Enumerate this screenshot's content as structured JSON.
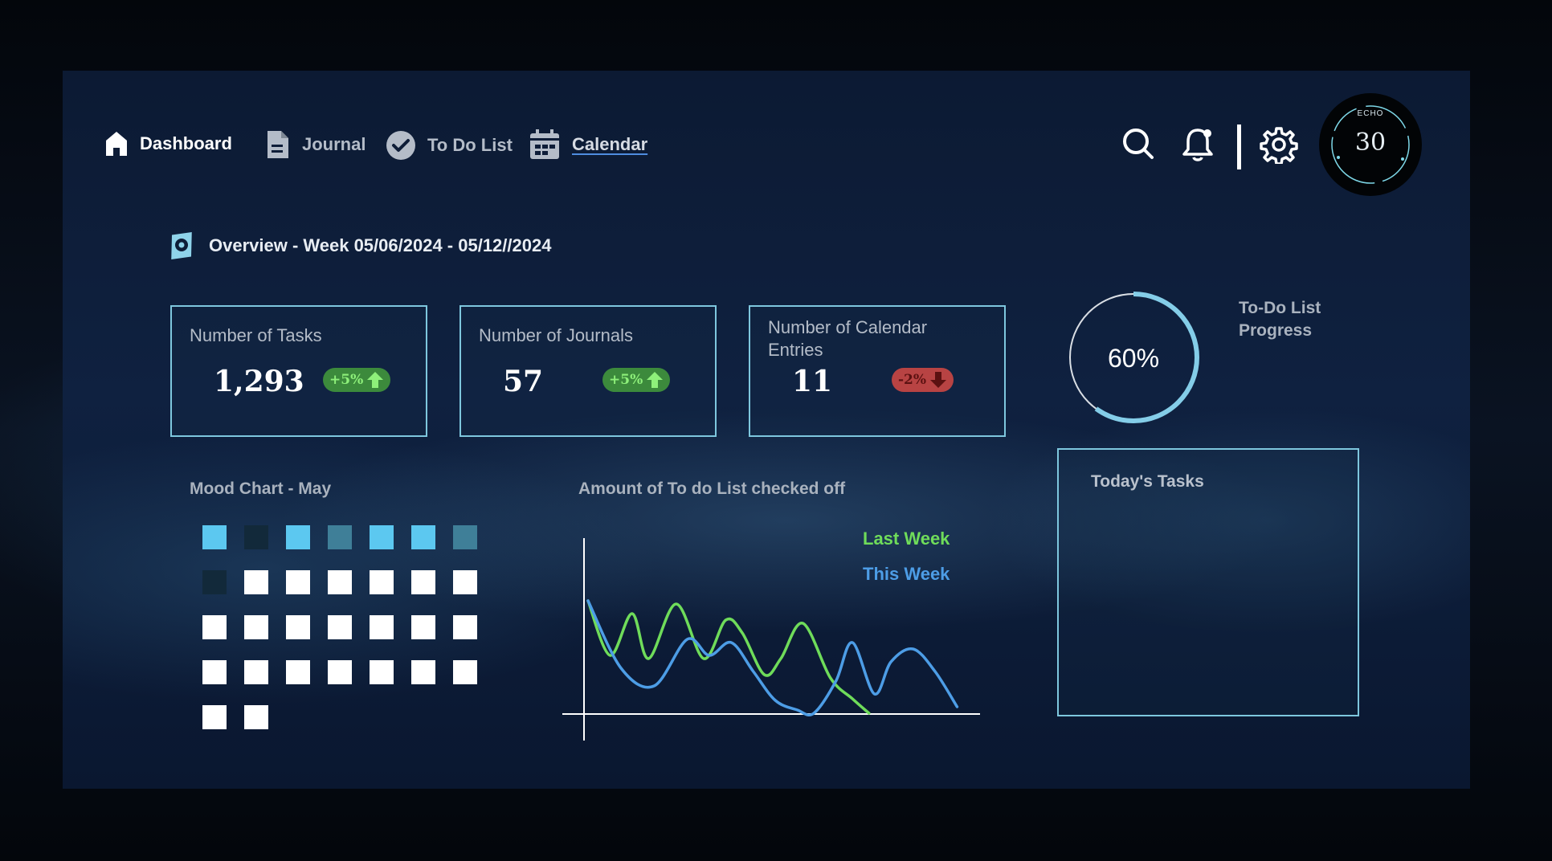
{
  "nav": {
    "items": [
      {
        "label": "Dashboard",
        "icon": "home-icon"
      },
      {
        "label": "Journal",
        "icon": "document-icon"
      },
      {
        "label": "To Do List",
        "icon": "check-circle-icon"
      },
      {
        "label": "Calendar",
        "icon": "calendar-icon"
      }
    ],
    "actions": [
      "search-icon",
      "bell-icon",
      "gear-icon"
    ],
    "badge": {
      "top_text": "ECHO",
      "number": "30"
    }
  },
  "overview": {
    "title": "Overview - Week 05/06/2024 - 05/12//2024",
    "icon": "camera-lens-icon"
  },
  "stats": [
    {
      "title": "Number of Tasks",
      "value": "1,293",
      "change": "+5%",
      "direction": "up"
    },
    {
      "title": "Number of Journals",
      "value": "57",
      "change": "+5%",
      "direction": "up"
    },
    {
      "title": "Number of Calendar Entries",
      "value": "11",
      "change": "-2%",
      "direction": "down"
    }
  ],
  "progress": {
    "value_text": "60%",
    "fraction": 0.6,
    "label": "To-Do List Progress"
  },
  "mood": {
    "title": "Mood Chart - May",
    "colors": {
      "bright": "#5cc8f0",
      "dark": "#12293a",
      "muted": "#3f7f98",
      "empty": "#ffffff"
    },
    "cells": [
      "bright",
      "dark",
      "bright",
      "muted",
      "bright",
      "bright",
      "muted",
      "dark",
      "empty",
      "empty",
      "empty",
      "empty",
      "empty",
      "empty",
      "empty",
      "empty",
      "empty",
      "empty",
      "empty",
      "empty",
      "empty",
      "empty",
      "empty",
      "empty",
      "empty",
      "empty",
      "empty",
      "empty",
      "empty",
      "empty"
    ]
  },
  "todays_tasks": {
    "title": "Today's Tasks"
  },
  "chart_data": {
    "type": "line",
    "title": "Amount of To do List checked off",
    "xlabel": "",
    "ylabel": "",
    "grid": false,
    "legend_placement": "top-right",
    "series": [
      {
        "name": "Last Week",
        "color": "#6fdc5a",
        "points": [
          [
            0,
            70
          ],
          [
            4,
            36
          ],
          [
            8,
            62
          ],
          [
            11,
            34
          ],
          [
            16,
            68
          ],
          [
            21,
            34
          ],
          [
            25,
            58
          ],
          [
            28,
            50
          ],
          [
            32,
            24
          ],
          [
            35,
            34
          ],
          [
            39,
            56
          ],
          [
            44,
            22
          ],
          [
            48,
            9
          ],
          [
            51,
            0
          ]
        ]
      },
      {
        "name": "This Week",
        "color": "#4d9de6",
        "points": [
          [
            0,
            70
          ],
          [
            6,
            28
          ],
          [
            12,
            17
          ],
          [
            18,
            46
          ],
          [
            22,
            36
          ],
          [
            26,
            44
          ],
          [
            30,
            26
          ],
          [
            34,
            8
          ],
          [
            38,
            2
          ],
          [
            41,
            0
          ],
          [
            45,
            20
          ],
          [
            48,
            44
          ],
          [
            52,
            12
          ],
          [
            55,
            32
          ],
          [
            59,
            40
          ],
          [
            63,
            26
          ],
          [
            67,
            4
          ]
        ]
      }
    ],
    "xlim": [
      0,
      70
    ],
    "ylim": [
      0,
      100
    ]
  }
}
